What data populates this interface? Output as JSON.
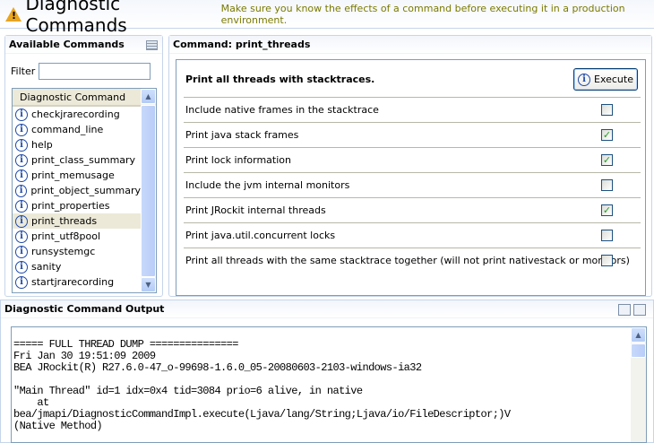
{
  "header": {
    "title": "Diagnostic Commands",
    "subtitle": "Make sure you know the effects of a command before executing it in a production environment."
  },
  "left": {
    "title": "Available Commands",
    "filter_label": "Filter",
    "filter_value": "",
    "column_header": "Diagnostic Command",
    "items": [
      "checkjrarecording",
      "command_line",
      "help",
      "print_class_summary",
      "print_memusage",
      "print_object_summary",
      "print_properties",
      "print_threads",
      "print_utf8pool",
      "runsystemgc",
      "sanity",
      "startjrarecording"
    ],
    "selected": "print_threads"
  },
  "right": {
    "title": "Command: print_threads",
    "description": "Print all threads with stacktraces.",
    "execute_label": "Execute",
    "options": [
      {
        "label": "Include native frames in the stacktrace",
        "checked": false
      },
      {
        "label": "Print java stack frames",
        "checked": true
      },
      {
        "label": "Print lock information",
        "checked": true
      },
      {
        "label": "Include the jvm internal monitors",
        "checked": false
      },
      {
        "label": "Print JRockit internal threads",
        "checked": true
      },
      {
        "label": "Print java.util.concurrent locks",
        "checked": false
      },
      {
        "label": "Print all threads with the same stacktrace together (will not print nativestack or monitors)",
        "checked": false
      }
    ]
  },
  "output": {
    "title": "Diagnostic Command Output",
    "text": "===== FULL THREAD DUMP ===============\nFri Jan 30 19:51:09 2009\nBEA JRockit(R) R27.6.0-47_o-99698-1.6.0_05-20080603-2103-windows-ia32\n\n\"Main Thread\" id=1 idx=0x4 tid=3084 prio=6 alive, in native\n    at\nbea/jmapi/DiagnosticCommandImpl.execute(Ljava/lang/String;Ljava/io/FileDescriptor;)V\n(Native Method)"
  }
}
